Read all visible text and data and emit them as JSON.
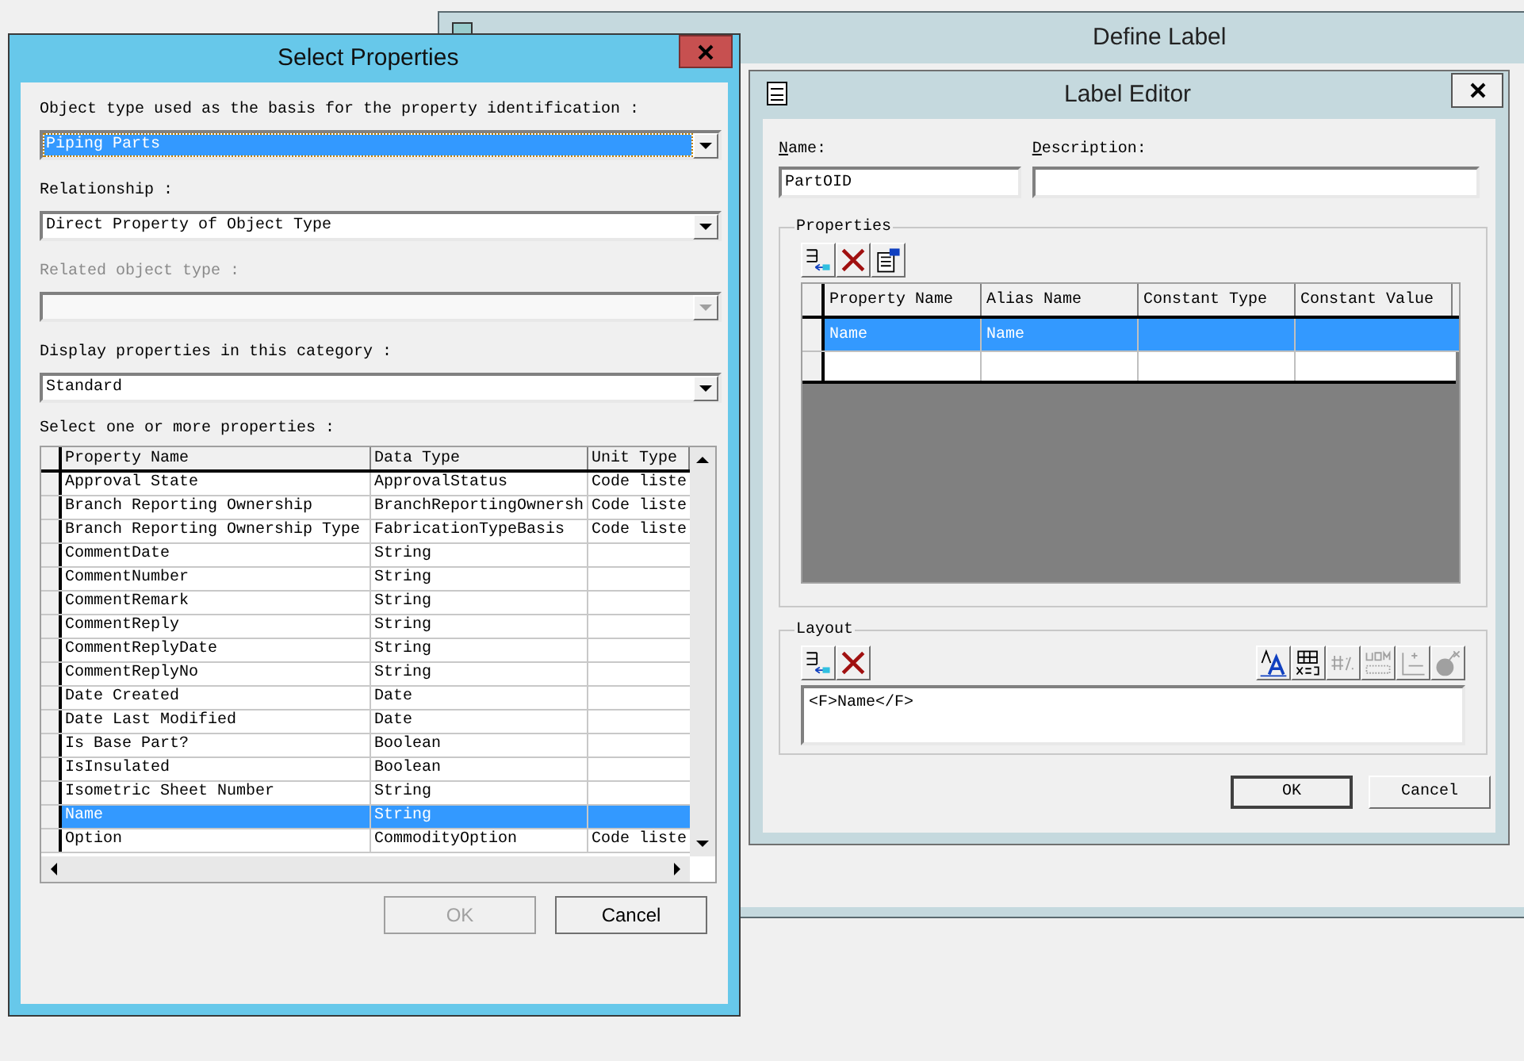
{
  "define_label": {
    "title": "Define Label"
  },
  "label_editor": {
    "title": "Label Editor",
    "name_label": "Name:",
    "name_value": "PartOID",
    "description_label": "Description:",
    "properties_group": "Properties",
    "properties_tools": [
      {
        "kind": "add"
      },
      {
        "kind": "delete"
      },
      {
        "kind": "properties"
      }
    ],
    "properties_columns": [
      "Property Name",
      "Alias Name",
      "Constant Type",
      "Constant Value"
    ],
    "properties_rows": [
      {
        "property_name": "Name",
        "alias_name": "Name",
        "selected": true
      }
    ],
    "layout_group": "Layout",
    "layout_tools_left": [
      {
        "kind": "add"
      },
      {
        "kind": "delete"
      }
    ],
    "layout_tools_right": [
      {
        "kind": "font",
        "disabled": false
      },
      {
        "kind": "table",
        "disabled": false
      },
      {
        "kind": "number",
        "disabled": true
      },
      {
        "kind": "uom",
        "disabled": true
      },
      {
        "kind": "axis",
        "disabled": true
      },
      {
        "kind": "bomb",
        "disabled": true
      }
    ],
    "layout_text": "<F>Name</F>",
    "buttons": [
      {
        "label": "OK"
      },
      {
        "label": "Cancel"
      }
    ]
  },
  "select_properties": {
    "title": "Select Properties",
    "fields": [
      {
        "label": "Object type used as the basis for the property identification :",
        "value": "Piping Parts",
        "focused": true,
        "disabled": false
      },
      {
        "label": "Relationship :",
        "value": "Direct Property of Object Type",
        "focused": false,
        "disabled": false
      },
      {
        "label": "Related object type :",
        "focused": false,
        "disabled": true
      },
      {
        "label": "Display properties in this category :",
        "value": "Standard",
        "focused": false,
        "disabled": false
      }
    ],
    "grid_label": "Select one or more properties :",
    "columns": [
      "Property Name",
      "Data Type",
      "Unit Type"
    ],
    "rows": [
      {
        "property_name": "Approval State",
        "data_type": "ApprovalStatus",
        "unit_type": "Code liste",
        "selected": false
      },
      {
        "property_name": "Branch Reporting Ownership",
        "data_type": "BranchReportingOwnersh",
        "unit_type": "Code liste",
        "selected": false
      },
      {
        "property_name": "Branch Reporting Ownership Type",
        "data_type": "FabricationTypeBasis",
        "unit_type": "Code liste",
        "selected": false
      },
      {
        "property_name": "CommentDate",
        "data_type": "String",
        "selected": false
      },
      {
        "property_name": "CommentNumber",
        "data_type": "String",
        "selected": false
      },
      {
        "property_name": "CommentRemark",
        "data_type": "String",
        "selected": false
      },
      {
        "property_name": "CommentReply",
        "data_type": "String",
        "selected": false
      },
      {
        "property_name": "CommentReplyDate",
        "data_type": "String",
        "selected": false
      },
      {
        "property_name": "CommentReplyNo",
        "data_type": "String",
        "selected": false
      },
      {
        "property_name": "Date Created",
        "data_type": "Date",
        "selected": false
      },
      {
        "property_name": "Date Last Modified",
        "data_type": "Date",
        "selected": false
      },
      {
        "property_name": "Is Base Part?",
        "data_type": "Boolean",
        "selected": false
      },
      {
        "property_name": "IsInsulated",
        "data_type": "Boolean",
        "selected": false
      },
      {
        "property_name": "Isometric Sheet Number",
        "data_type": "String",
        "selected": false
      },
      {
        "property_name": "Name",
        "data_type": "String",
        "selected": true
      },
      {
        "property_name": "Option",
        "data_type": "CommodityOption",
        "unit_type": "Code liste",
        "selected": false
      }
    ],
    "buttons": [
      {
        "label": "OK",
        "disabled": true
      },
      {
        "label": "Cancel",
        "disabled": false
      }
    ]
  }
}
